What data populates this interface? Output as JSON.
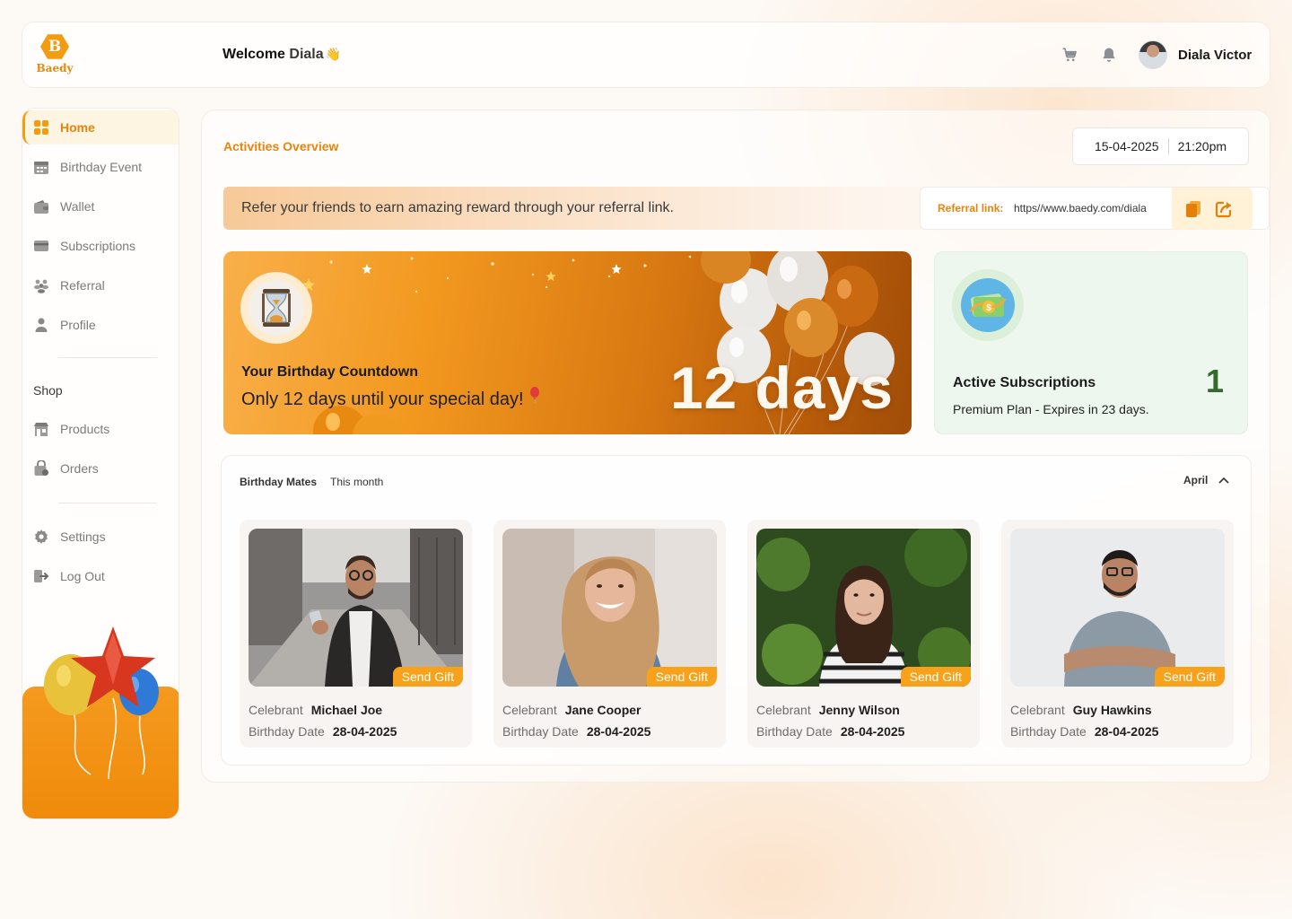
{
  "brand": {
    "logo_letter": "B",
    "name": "Baedy"
  },
  "header": {
    "welcome": "Welcome",
    "user_first": "Diala",
    "wave": "👋",
    "user_full": "Diala Victor"
  },
  "sidebar": {
    "items": [
      {
        "label": "Home",
        "icon": "grid-icon"
      },
      {
        "label": "Birthday Event",
        "icon": "calendar-icon"
      },
      {
        "label": "Wallet",
        "icon": "wallet-icon"
      },
      {
        "label": "Subscriptions",
        "icon": "card-icon"
      },
      {
        "label": "Referral",
        "icon": "people-icon"
      },
      {
        "label": "Profile",
        "icon": "user-icon"
      }
    ],
    "shop_label": "Shop",
    "shop_items": [
      {
        "label": "Products",
        "icon": "store-icon"
      },
      {
        "label": "Orders",
        "icon": "bag-icon"
      }
    ],
    "bottom_items": [
      {
        "label": "Settings",
        "icon": "gear-icon"
      },
      {
        "label": "Log Out",
        "icon": "logout-icon"
      }
    ]
  },
  "main": {
    "title": "Activities Overview",
    "date": "15-04-2025",
    "time": "21:20pm",
    "referral": {
      "message": "Refer your friends to earn amazing reward through your referral link.",
      "label": "Referral link:",
      "url": "https//www.baedy.com/diala"
    },
    "countdown": {
      "title": "Your Birthday Countdown",
      "subtitle": "Only 12 days until your special day!",
      "big": "12 days"
    },
    "subscriptions": {
      "title": "Active Subscriptions",
      "detail": "Premium Plan - Expires in 23 days.",
      "count": "1"
    },
    "mates": {
      "title": "Birthday Mates",
      "period": "This month",
      "month": "April",
      "celebrant_label": "Celebrant",
      "date_label": "Birthday Date",
      "gift_label": "Send Gift",
      "people": [
        {
          "name": "Michael Joe",
          "date": "28-04-2025"
        },
        {
          "name": "Jane Cooper",
          "date": "28-04-2025"
        },
        {
          "name": "Jenny Wilson",
          "date": "28-04-2025"
        },
        {
          "name": "Guy Hawkins",
          "date": "28-04-2025"
        }
      ]
    }
  },
  "colors": {
    "accent": "#f39c12",
    "accent_text": "#e8850c",
    "subs_bg": "#eef7ee",
    "subs_count": "#356a2e"
  }
}
